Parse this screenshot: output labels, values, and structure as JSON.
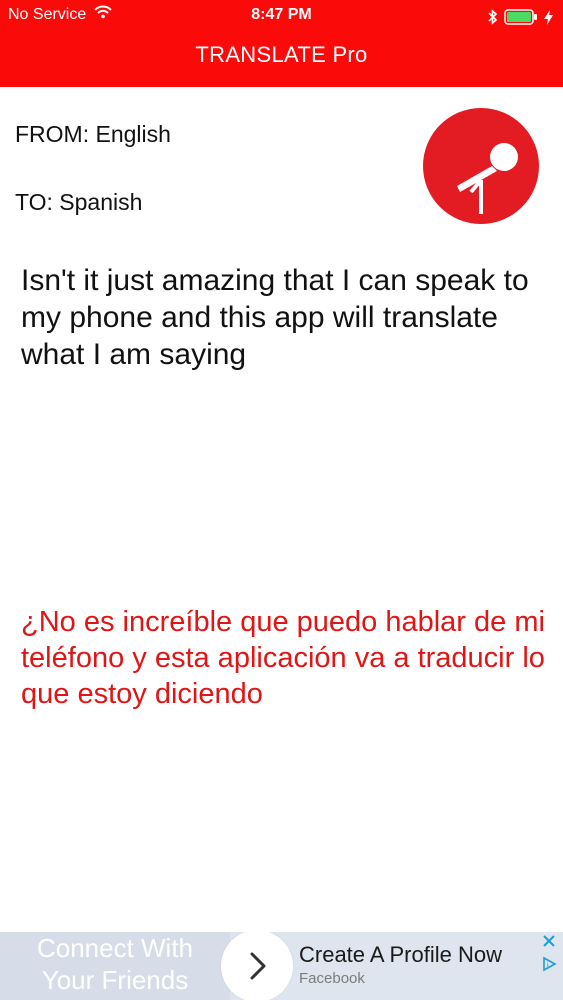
{
  "status_bar": {
    "carrier": "No Service",
    "time": "8:47 PM",
    "icons": [
      "wifi-icon",
      "bluetooth-icon",
      "battery-icon",
      "charging-bolt-icon"
    ]
  },
  "app": {
    "title": "TRANSLATE Pro",
    "from_label": "FROM: English",
    "to_label": "TO: Spanish",
    "mic_icon": "microphone-icon",
    "source_text": "Isn't it just amazing that I can speak to my phone and this app will translate what I am saying",
    "translated_text": "¿No es increíble que puedo hablar de mi teléfono y esta aplicación va a traducir lo que estoy diciendo"
  },
  "ad": {
    "left_line1": "Connect With",
    "left_line2": "Your Friends",
    "title": "Create A Profile Now",
    "subtitle": "Facebook",
    "icons": [
      "chevron-right-icon",
      "close-icon",
      "ad-choices-icon"
    ]
  },
  "colors": {
    "header_red": "#fb0a0a",
    "mic_red": "#e31b23",
    "translation_red": "#e01515",
    "battery_green": "#4cd964"
  }
}
